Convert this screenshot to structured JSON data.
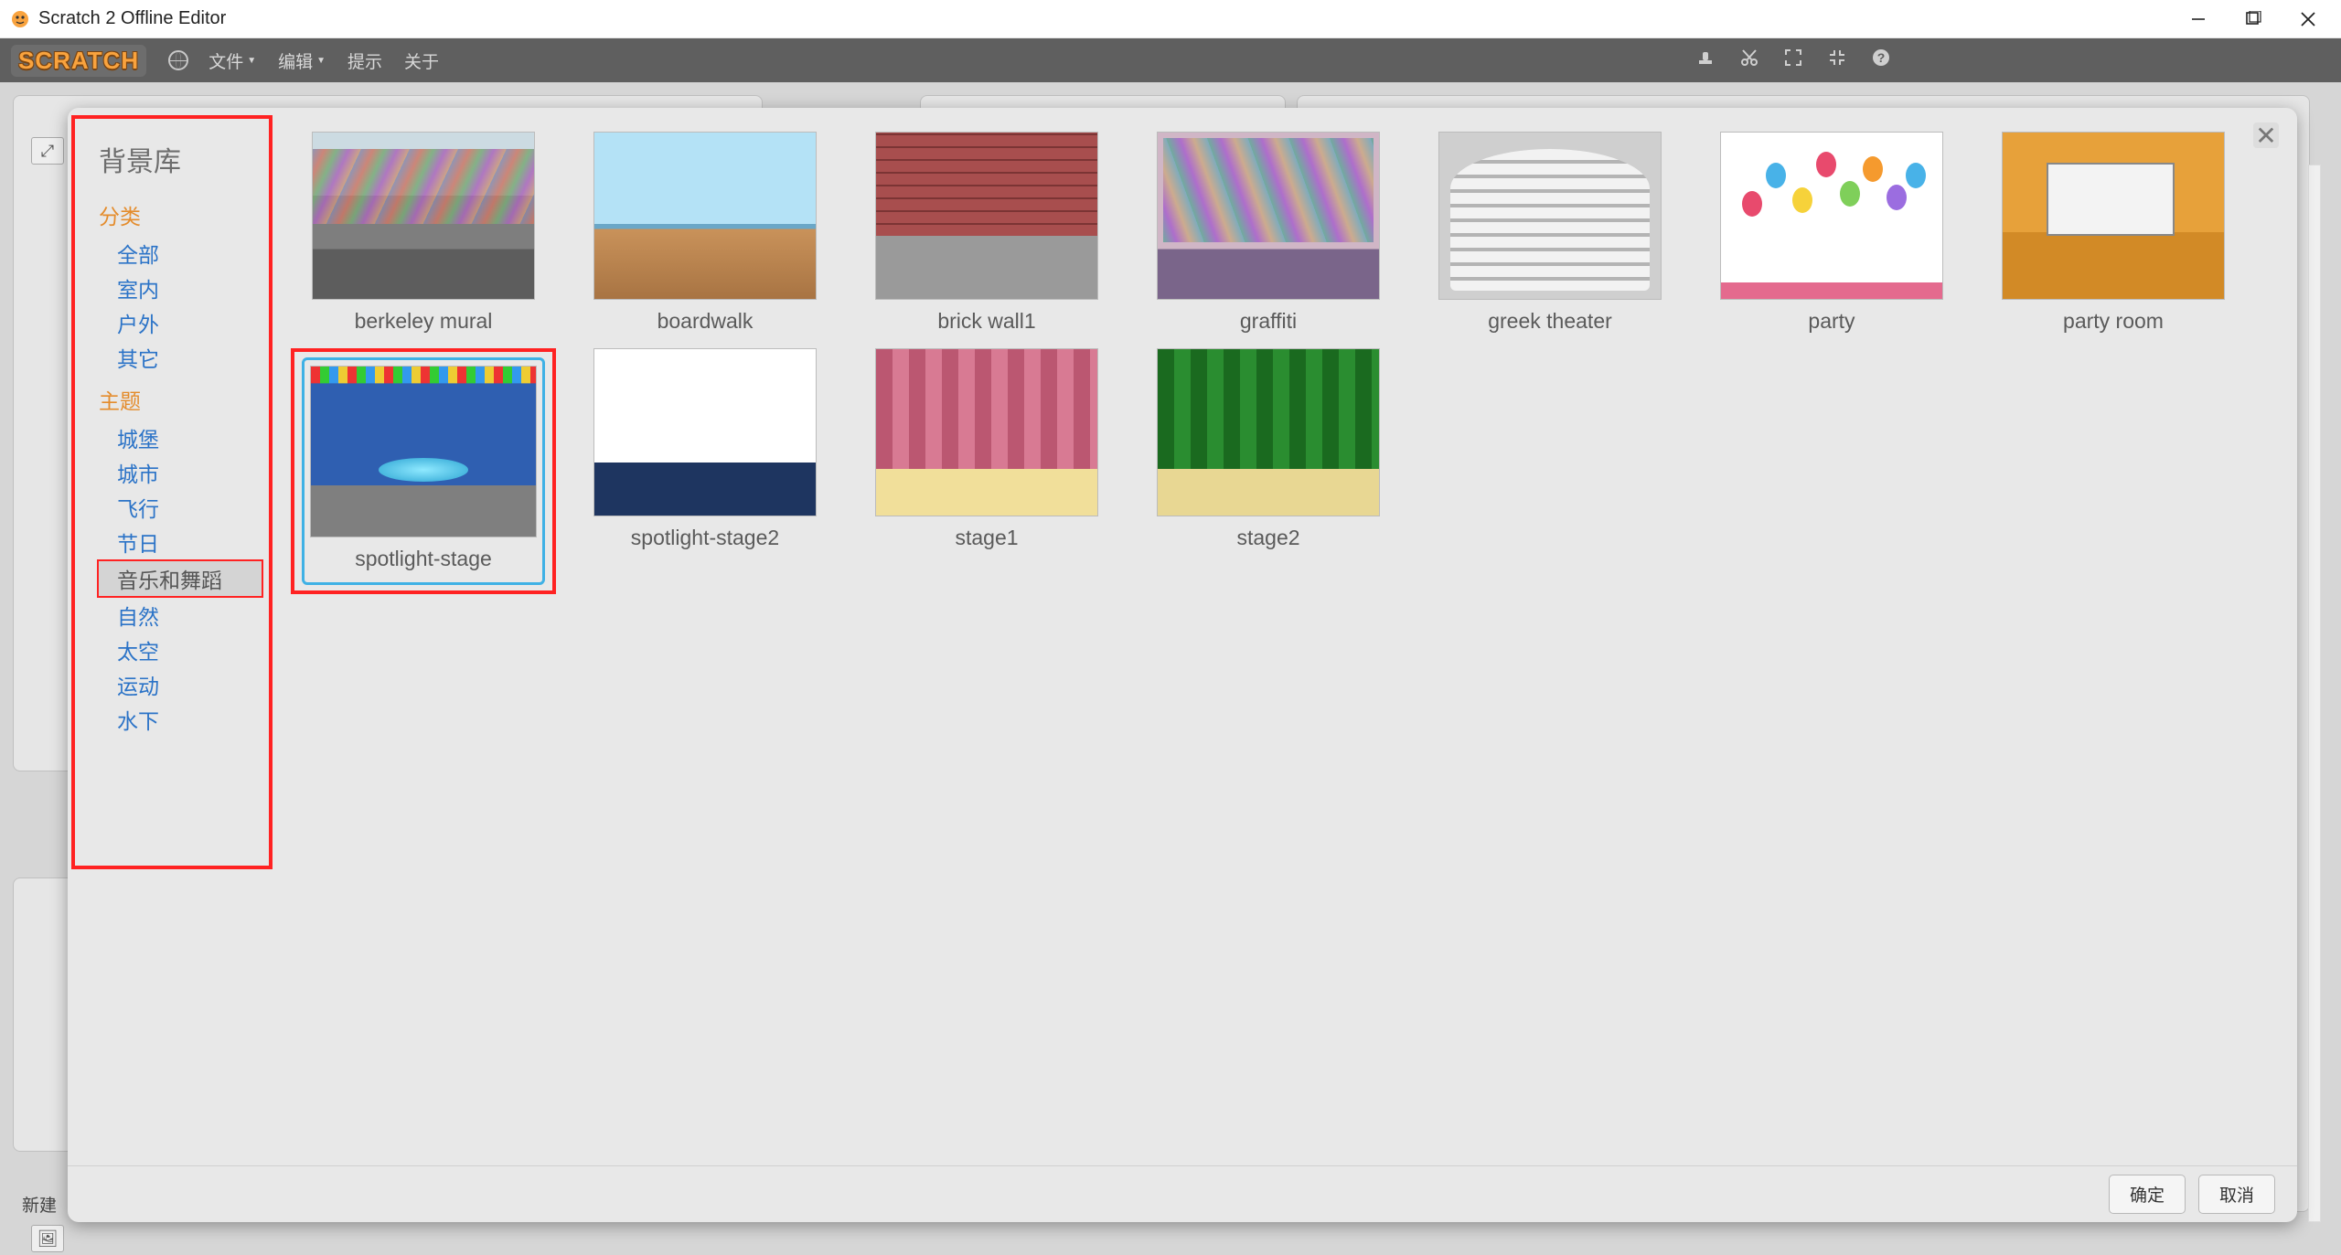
{
  "window": {
    "title": "Scratch 2 Offline Editor"
  },
  "menubar": {
    "logo": "SCRATCH",
    "items": [
      "文件",
      "编辑",
      "提示",
      "关于"
    ]
  },
  "back": {
    "new_sprite_label": "新建"
  },
  "dialog": {
    "title": "背景库",
    "close_tooltip": "关闭",
    "buttons": {
      "ok": "确定",
      "cancel": "取消"
    },
    "sidebar": {
      "category_header": "分类",
      "categories": [
        "全部",
        "室内",
        "户外",
        "其它"
      ],
      "theme_header": "主题",
      "themes": [
        "城堡",
        "城市",
        "飞行",
        "节日",
        "音乐和舞蹈",
        "自然",
        "太空",
        "运动",
        "水下"
      ],
      "selected_theme_index": 4
    },
    "tiles": [
      {
        "label": "berkeley mural",
        "art": "art-mural"
      },
      {
        "label": "boardwalk",
        "art": "art-boardwalk"
      },
      {
        "label": "brick wall1",
        "art": "art-brick"
      },
      {
        "label": "graffiti",
        "art": "art-graffiti"
      },
      {
        "label": "greek theater",
        "art": "art-greek"
      },
      {
        "label": "party",
        "art": "art-party"
      },
      {
        "label": "party room",
        "art": "art-partyroom"
      },
      {
        "label": "spotlight-stage",
        "art": "art-spot1",
        "selected": true
      },
      {
        "label": "spotlight-stage2",
        "art": "art-spot2"
      },
      {
        "label": "stage1",
        "art": "art-stage1"
      },
      {
        "label": "stage2",
        "art": "art-stage2"
      }
    ]
  }
}
